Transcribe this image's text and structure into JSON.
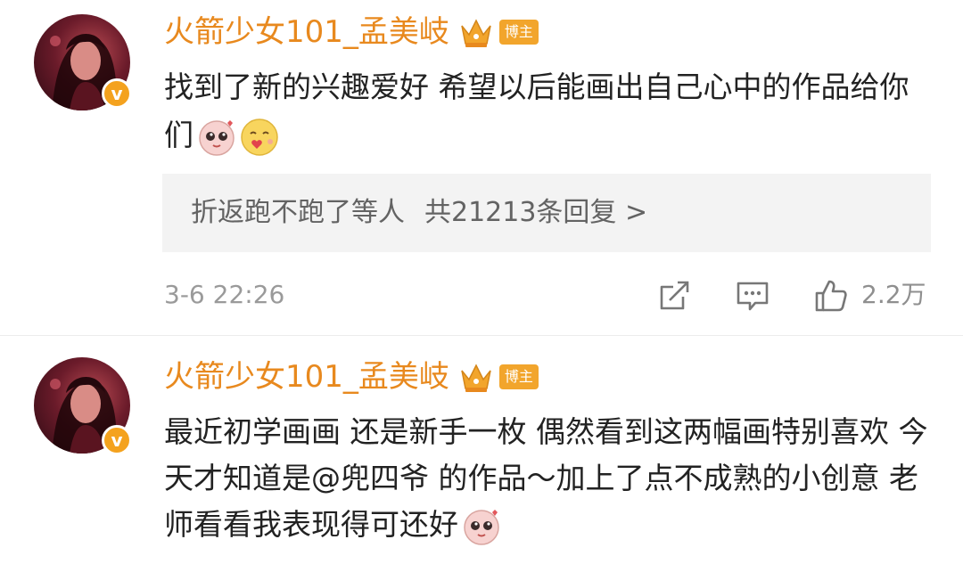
{
  "comments": [
    {
      "username": "火箭少女101_孟美岐",
      "verified_mark": "v",
      "role_badge": "博主",
      "text": "找到了新的兴趣爱好 希望以后能画出自己心中的作品给你们",
      "emojis": [
        "cute-face-emoji",
        "heart-face-emoji"
      ],
      "reply_preview": {
        "user": "折返跑不跑了等人",
        "summary": "共21213条回复 >"
      },
      "timestamp": "3-6 22:26",
      "like_count": "2.2万"
    },
    {
      "username": "火箭少女101_孟美岐",
      "verified_mark": "v",
      "role_badge": "博主",
      "text": "最近初学画画 还是新手一枚 偶然看到这两幅画特别喜欢 今天才知道是@兜四爷 的作品～加上了点不成熟的小创意 老师看看我表现得可还好",
      "emojis": [
        "cute-face-emoji"
      ]
    }
  ],
  "colors": {
    "username": "#e8891e",
    "badge": "#f2a52c",
    "text": "#222222",
    "reply_bg": "#f3f3f3",
    "meta": "#9a9a9a"
  },
  "icons": [
    "crown-icon",
    "share-icon",
    "comment-icon",
    "like-icon"
  ]
}
